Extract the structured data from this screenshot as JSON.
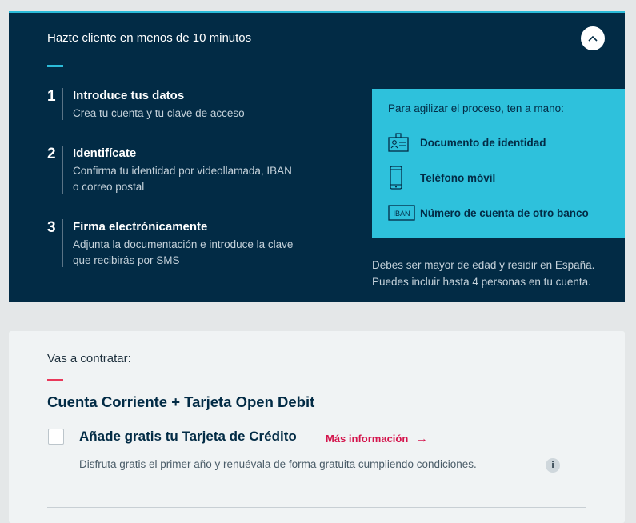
{
  "panel": {
    "title": "Hazte cliente en menos de 10 minutos",
    "collapse_icon": "chevron-up-icon",
    "steps": [
      {
        "number": "1",
        "title": "Introduce tus datos",
        "lines": [
          "Crea tu cuenta y tu clave de acceso"
        ]
      },
      {
        "number": "2",
        "title": "Identifícate",
        "lines": [
          "Confirma tu identidad por videollamada, IBAN",
          "o correo postal"
        ]
      },
      {
        "number": "3",
        "title": "Firma electrónicamente",
        "lines": [
          "Adjunta la documentación e introduce la clave",
          "que recibirás por SMS"
        ]
      }
    ],
    "info_box": {
      "heading": "Para agilizar el proceso, ten a mano:",
      "items": [
        {
          "icon": "id-card-icon",
          "label": "Documento de identidad"
        },
        {
          "icon": "mobile-phone-icon",
          "label": "Teléfono móvil"
        },
        {
          "icon": "iban-icon",
          "icon_text": "IBAN",
          "label": "Número de cuenta de otro banco"
        }
      ]
    },
    "note_lines": [
      "Debes ser mayor de edad y residir en España.",
      "Puedes incluir hasta 4 personas en tu cuenta."
    ]
  },
  "contract": {
    "pre_title": "Vas a contratar:",
    "product": "Cuenta Corriente + Tarjeta Open Debit",
    "option_label": "Añade gratis tu Tarjeta de Crédito",
    "more_info": "Más información",
    "arrow": "→",
    "option_desc": "Disfruta gratis el primer año y renuévala de forma gratuita cumpliendo condiciones.",
    "info_glyph": "i"
  },
  "colors": {
    "panel_bg": "#022b45",
    "accent_cyan": "#2ec1dc",
    "accent_red": "#e9385a",
    "link_red": "#d4144c",
    "card_bg": "#f0f3f4"
  }
}
